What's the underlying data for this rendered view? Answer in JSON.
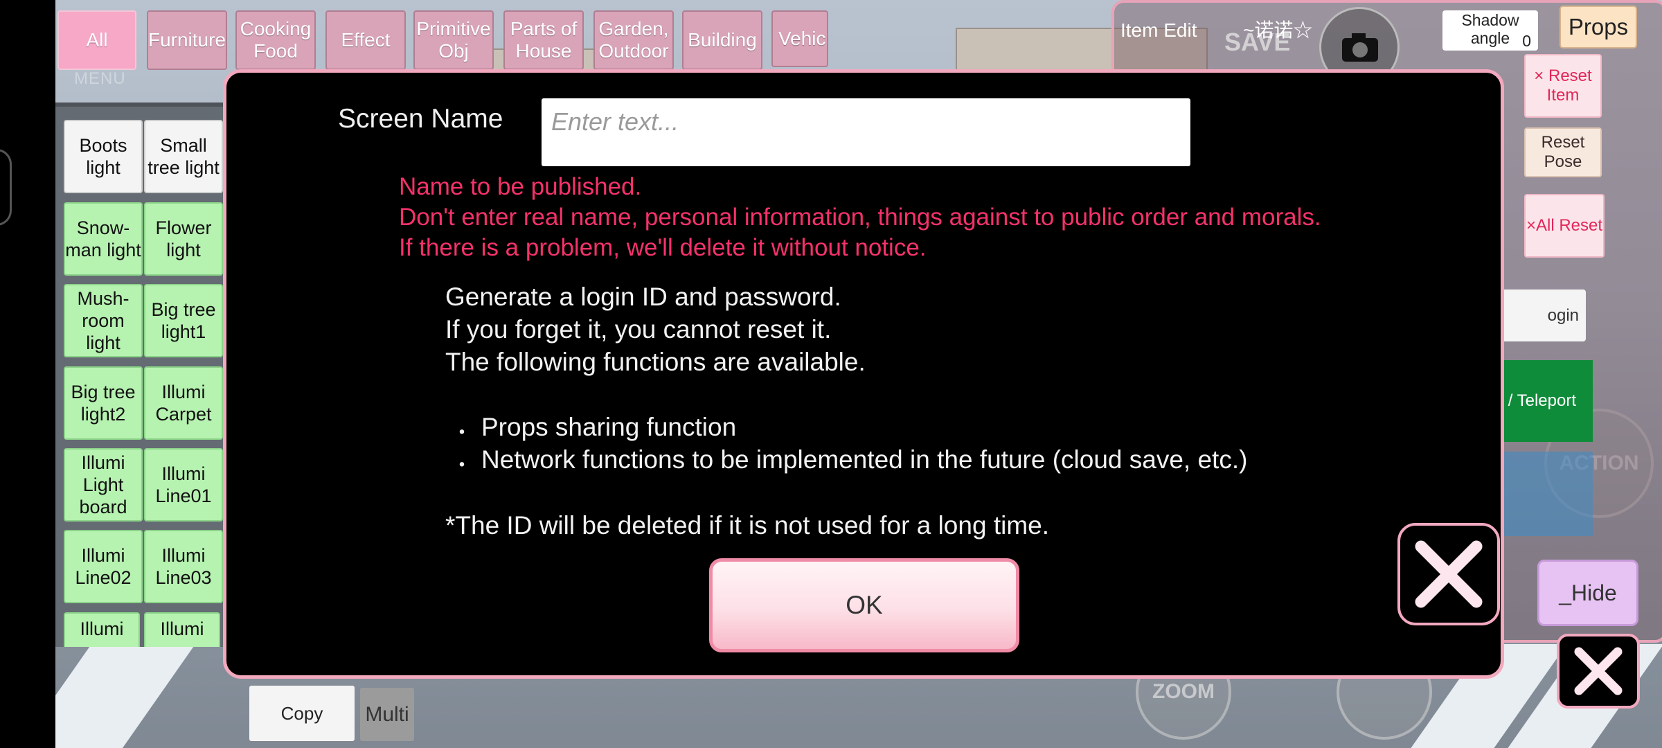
{
  "categories": [
    {
      "label": "All",
      "active": true
    },
    {
      "label": "Furniture",
      "active": false
    },
    {
      "label": "Cooking Food",
      "active": false
    },
    {
      "label": "Effect",
      "active": false
    },
    {
      "label": "Primitive Obj",
      "active": false
    },
    {
      "label": "Parts of House",
      "active": false
    },
    {
      "label": "Garden, Outdoor",
      "active": false
    },
    {
      "label": "Building",
      "active": false
    },
    {
      "label": "Vehic",
      "active": false
    }
  ],
  "menu_label": "MENU",
  "items": [
    "Boots light",
    "Small tree light",
    "Snow-man light",
    "Flower light",
    "Mush-room light",
    "Big tree light1",
    "Big tree light2",
    "Illumi Carpet",
    "Illumi Light board",
    "Illumi Line01",
    "Illumi Line02",
    "Illumi Line03",
    "Illumi",
    "Illumi"
  ],
  "right_panel": {
    "item_edit": "Item Edit",
    "save": "SAVE",
    "player_name": "~诺诺☆",
    "shadow_label": "Shadow angle",
    "shadow_value": "0",
    "props": "Props",
    "reset_item": "× Reset Item",
    "reset_pose": "Reset Pose",
    "all_reset": "×All Reset",
    "login": "ogin",
    "teleport": "/ Teleport",
    "hide": "_Hide"
  },
  "bottom": {
    "copy": "Copy",
    "multi": "Multi",
    "zoom": "ZOOM",
    "action": "ACTION"
  },
  "dialog": {
    "screen_name_label": "Screen Name",
    "screen_name_value": "",
    "screen_name_placeholder": "Enter text...",
    "warnings": [
      "Name to be published.",
      "Don't enter real name, personal information, things against to public order and morals.",
      "If there is a problem, we'll delete it without notice."
    ],
    "info_lines": [
      "Generate a login ID and password.",
      "If you forget it, you cannot reset it.",
      "The following functions are available."
    ],
    "bullet_char": "・",
    "bullets": [
      "Props sharing function",
      "Network functions to be implemented in the future (cloud save, etc.)"
    ],
    "note": "*The ID will be deleted if it is not used for a long time.",
    "ok": "OK"
  },
  "colors": {
    "warning_text": "#f5326a",
    "dialog_border": "#f2a8bd",
    "item_green": "#b6f2b0",
    "tab_pink": "#d9a4b8"
  }
}
